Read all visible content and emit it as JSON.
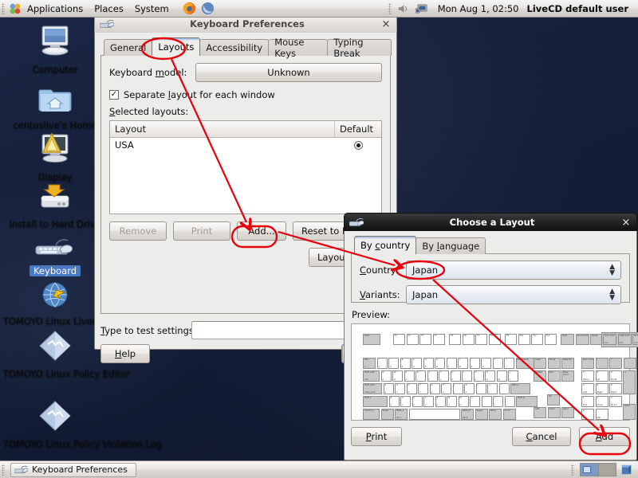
{
  "top_panel": {
    "menus": [
      "Applications",
      "Places",
      "System"
    ],
    "launchers": [
      "firefox-icon",
      "evolution-icon"
    ],
    "tray_icons": [
      "volume-icon",
      "network-monitor-icon"
    ],
    "clock": "Mon Aug  1, 02:50",
    "user": "LiveCD default user",
    "menu_icon": "gnome-foot-icon"
  },
  "desktop": {
    "icons": [
      {
        "label": "Computer",
        "icon": "computer-icon",
        "selected": false
      },
      {
        "label": "centoslive's Home",
        "icon": "home-folder-icon",
        "selected": false
      },
      {
        "label": "Display",
        "icon": "display-icon",
        "selected": false
      },
      {
        "label": "Install to Hard Drive",
        "icon": "hard-drive-icon",
        "selected": false
      },
      {
        "label": "Keyboard",
        "icon": "keyboard-icon",
        "selected": true
      },
      {
        "label": "TOMOYO Linux LiveCD Tutorial",
        "icon": "globe-icon",
        "selected": false
      },
      {
        "label": "TOMOYO Linux Policy Editor",
        "icon": "diamond-icon",
        "selected": false
      },
      {
        "label": "TOMOYO Linux Policy Violation Log",
        "icon": "diamond-icon",
        "selected": false
      }
    ]
  },
  "bottom_panel": {
    "task_label": "Keyboard Preferences",
    "task_icon": "keyboard-icon",
    "workspaces": [
      "workspace-1",
      "workspace-2"
    ],
    "trash_icon": "trash-icon"
  },
  "keyboard_prefs": {
    "title": "Keyboard Preferences",
    "window_icon": "keyboard-icon",
    "close_label": "×",
    "tabs": [
      {
        "label": "General",
        "active": false
      },
      {
        "label": "Layouts",
        "active": true
      },
      {
        "label": "Accessibility",
        "active": false
      },
      {
        "label": "Mouse Keys",
        "active": false
      },
      {
        "label": "Typing Break",
        "active": false
      }
    ],
    "model_label": "Keyboard model:",
    "model_value": "Unknown",
    "separate_layout_label": "Separate layout for each window",
    "separate_layout_checked": true,
    "selected_layouts_label": "Selected layouts:",
    "list_columns": [
      "Layout",
      "Default"
    ],
    "list_rows": [
      {
        "layout": "USA",
        "default": true
      }
    ],
    "buttons": {
      "remove": "Remove",
      "remove_disabled": true,
      "print": "Print",
      "print_disabled": true,
      "add": "Add...",
      "reset": "Reset to D",
      "layout_options": "Layout Op",
      "help": "Help"
    },
    "test_label": "Type to test settings:",
    "test_value": ""
  },
  "choose_layout": {
    "title": "Choose a Layout",
    "window_icon": "keyboard-icon",
    "close_label": "×",
    "tabs": [
      {
        "label": "By country",
        "active": true
      },
      {
        "label": "By language",
        "active": false
      }
    ],
    "country_label": "Country:",
    "country_value": "Japan",
    "variants_label": "Variants:",
    "variants_value": "Japan",
    "preview_label": "Preview:",
    "buttons": {
      "print": "Print",
      "cancel": "Cancel",
      "add": "Add"
    },
    "combo_arrows": "⌃⌄"
  },
  "annotations": {
    "color": "#e8000d",
    "highlights": [
      {
        "target": "layouts-tab"
      },
      {
        "target": "add-button"
      },
      {
        "target": "country-combo"
      },
      {
        "target": "add-layout-button"
      }
    ],
    "arrows": [
      {
        "from": "layouts-tab",
        "to": "add-button"
      },
      {
        "from": "add-button",
        "to": "country-combo"
      },
      {
        "from": "country-combo",
        "to": "add-layout-button"
      }
    ]
  }
}
